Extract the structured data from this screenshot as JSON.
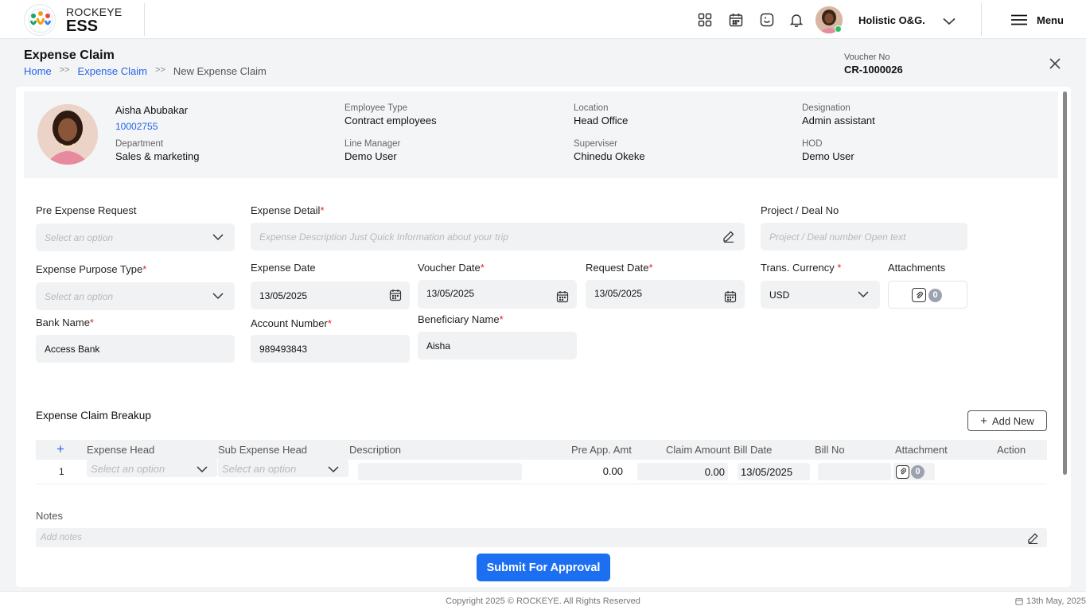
{
  "header": {
    "brand_top": "ROCKEYE",
    "brand_bottom": "ESS",
    "user_name": "Holistic O&G.",
    "menu_label": "Menu"
  },
  "page": {
    "title": "Expense Claim",
    "breadcrumb": [
      "Home",
      "Expense Claim",
      "New Expense Claim"
    ],
    "voucher_label": "Voucher No",
    "voucher_value": "CR-1000026"
  },
  "employee": {
    "name": "Aisha Abubakar",
    "id": "10002755",
    "department_label": "Department",
    "department": "Sales & marketing",
    "employee_type_label": "Employee Type",
    "employee_type": "Contract employees",
    "line_manager_label": "Line Manager",
    "line_manager": "Demo User",
    "location_label": "Location",
    "location": "Head Office",
    "supervisor_label": "Superviser",
    "supervisor": "Chinedu Okeke",
    "designation_label": "Designation",
    "designation": "Admin assistant",
    "hod_label": "HOD",
    "hod": "Demo User"
  },
  "form": {
    "pre_expense_label": "Pre Expense Request",
    "pre_expense_placeholder": "Select an option",
    "expense_detail_label": "Expense Detail",
    "expense_detail_placeholder": "Expense Description Just Quick Information about your trip",
    "project_label": "Project / Deal No",
    "project_placeholder": "Project / Deal number Open text",
    "purpose_label": "Expense Purpose Type",
    "purpose_placeholder": "Select an option",
    "expense_date_label": "Expense Date",
    "expense_date": "13/05/2025",
    "voucher_date_label": "Voucher Date",
    "voucher_date": "13/05/2025",
    "request_date_label": "Request Date",
    "request_date": "13/05/2025",
    "currency_label": "Trans. Currency",
    "currency": "USD",
    "attachments_label": "Attachments",
    "attachments_count": "0",
    "bank_label": "Bank Name",
    "bank": "Access Bank",
    "account_label": "Account Number",
    "account": "989493843",
    "beneficiary_label": "Beneficiary Name",
    "beneficiary": "Aisha",
    "required_mark": "*"
  },
  "breakup": {
    "title": "Expense Claim Breakup",
    "add_new": "Add New",
    "plus": "+",
    "columns": {
      "expense_head": "Expense Head",
      "sub_expense_head": "Sub Expense Head",
      "description": "Description",
      "pre_app_amt": "Pre App. Amt",
      "claim_amount": "Claim Amount",
      "bill_date": "Bill Date",
      "bill_no": "Bill No",
      "attachment": "Attachment",
      "action": "Action"
    },
    "rows": [
      {
        "index": "1",
        "expense_head_placeholder": "Select an option",
        "sub_expense_placeholder": "Select an option",
        "pre_app_amt": "0.00",
        "claim_amount": "0.00",
        "bill_date": "13/05/2025",
        "attachment_count": "0"
      }
    ]
  },
  "notes": {
    "label": "Notes",
    "placeholder": "Add notes"
  },
  "submit_label": "Submit For Approval",
  "footer": {
    "copyright": "Copyright 2025 © ROCKEYE. All Rights Reserved",
    "date": "13th May, 2025"
  },
  "colors": {
    "accent": "#1d6ff2",
    "link": "#2563eb",
    "required": "#dc2626",
    "online": "#22c55e"
  },
  "icons": [
    "apps-grid-icon",
    "calendar-icon",
    "chat-icon",
    "bell-icon",
    "chevron-down-icon",
    "hamburger-menu-icon",
    "close-icon",
    "pencil-icon",
    "paperclip-icon"
  ]
}
